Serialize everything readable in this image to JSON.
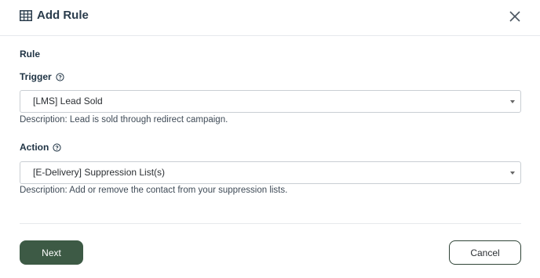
{
  "header": {
    "icon": "table-icon",
    "title": "Add Rule",
    "close_icon": "close-icon"
  },
  "form": {
    "section_label": "Rule",
    "trigger": {
      "label": "Trigger",
      "help_icon": "help-circle-icon",
      "selected": "[LMS] Lead Sold",
      "description": "Description: Lead is sold through redirect campaign."
    },
    "action": {
      "label": "Action",
      "help_icon": "help-circle-icon",
      "selected": "[E-Delivery] Suppression List(s)",
      "description": "Description: Add or remove the contact from your suppression lists."
    }
  },
  "footer": {
    "next_label": "Next",
    "cancel_label": "Cancel"
  },
  "colors": {
    "primary_button": "#3d5a45",
    "title_text": "#2a3c4c",
    "border": "#c9ced3"
  }
}
